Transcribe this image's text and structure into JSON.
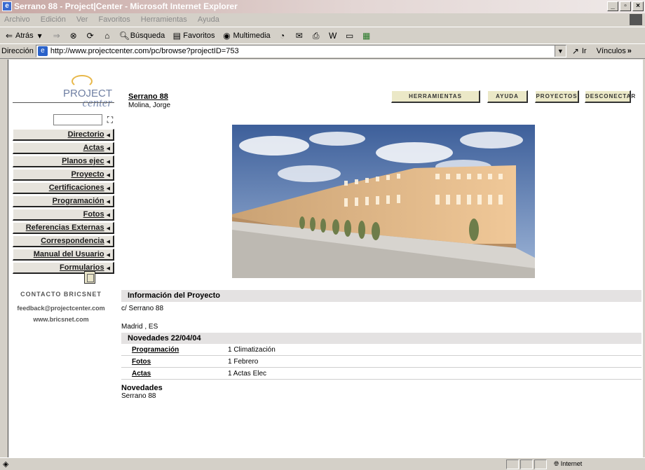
{
  "window": {
    "title": "Serrano 88 - Project|Center - Microsoft Internet Explorer"
  },
  "menu": [
    "Archivo",
    "Edición",
    "Ver",
    "Favoritos",
    "Herramientas",
    "Ayuda"
  ],
  "toolbar": {
    "back": "Atrás",
    "search": "Búsqueda",
    "favorites": "Favoritos",
    "multimedia": "Multimedia"
  },
  "address": {
    "label": "Dirección",
    "url": "http://www.projectcenter.com/pc/browse?projectID=753",
    "go": "Ir",
    "links": "Vínculos"
  },
  "status": {
    "zone": "Internet"
  },
  "logo": {
    "line1": "PROJECT",
    "line2": "center"
  },
  "nav": [
    "Directorio",
    "Actas",
    "Planos ejec",
    "Proyecto",
    "Certificaciones",
    "Programación",
    "Fotos",
    "Referencias Externas",
    "Correspondencia",
    "Manual del Usuario",
    "Formularios"
  ],
  "contact": {
    "title": "CONTACTO BRICSNET",
    "email": "feedback@projectcenter.com",
    "web": "www.bricsnet.com"
  },
  "project": {
    "name": "Serrano 88",
    "owner": "Molina, Jorge"
  },
  "top_buttons": [
    "HERRAMIENTAS",
    "AYUDA",
    "PROYECTOS",
    "DESCONECTAR"
  ],
  "info": {
    "header": "Información del Proyecto",
    "address1": "c/ Serrano 88",
    "address2": "Madrid , ES"
  },
  "novedades": {
    "header": "Novedades 22/04/04",
    "rows": [
      {
        "link": "Programación",
        "value": "1 Climatización"
      },
      {
        "link": "Fotos",
        "value": "1 Febrero"
      },
      {
        "link": "Actas",
        "value": "1 Actas Elec"
      }
    ]
  },
  "footer": {
    "title": "Novedades",
    "subtitle": "Serrano 88"
  },
  "colors": {
    "button_bg": "#ebe8c7",
    "nav_bg": "#e6e3dc",
    "header_bg": "#e4e2e2",
    "logo_blue": "#6f7fa3"
  }
}
